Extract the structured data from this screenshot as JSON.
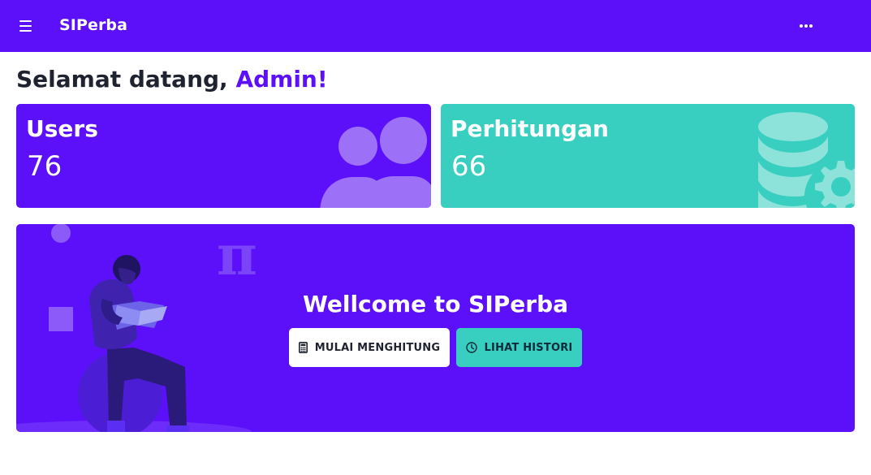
{
  "navbar": {
    "brand": "SIPerba",
    "menu_icon": "hamburger-menu-icon",
    "more_icon": "more-horizontal-icon",
    "background": "#5b10f9"
  },
  "greeting": {
    "prefix": "Selamat datang, ",
    "name": "Admin!"
  },
  "stats": {
    "users": {
      "title": "Users",
      "value": "76",
      "icon": "users-group-icon",
      "color": "#5b10f9"
    },
    "perhitungan": {
      "title": "Perhitungan",
      "value": "66",
      "icon": "database-settings-icon",
      "color": "#39cfc0"
    }
  },
  "hero": {
    "title": "Wellcome to SIPerba",
    "illustration": "person-reading-book-illustration",
    "buttons": {
      "start": {
        "label": "MULAI MENGHITUNG",
        "icon": "calculator-icon"
      },
      "history": {
        "label": "LIHAT HISTORI",
        "icon": "clock-icon"
      }
    }
  }
}
